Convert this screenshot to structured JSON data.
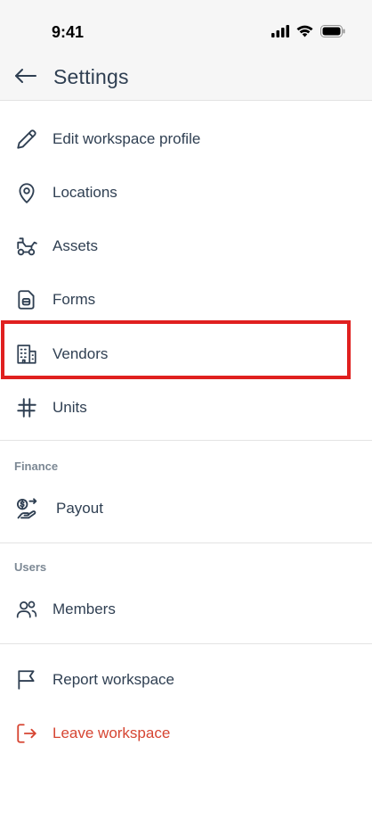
{
  "status_bar": {
    "time": "9:41"
  },
  "header": {
    "title": "Settings"
  },
  "general_items": [
    {
      "label": "Edit workspace profile",
      "icon": "pencil-icon"
    },
    {
      "label": "Locations",
      "icon": "map-pin-icon"
    },
    {
      "label": "Assets",
      "icon": "truck-icon"
    },
    {
      "label": "Forms",
      "icon": "form-icon"
    },
    {
      "label": "Vendors",
      "icon": "building-icon"
    },
    {
      "label": "Units",
      "icon": "hash-icon"
    }
  ],
  "finance": {
    "title": "Finance",
    "items": [
      {
        "label": "Payout",
        "icon": "payout-icon"
      }
    ]
  },
  "users": {
    "title": "Users",
    "items": [
      {
        "label": "Members",
        "icon": "users-icon"
      }
    ]
  },
  "workspace_items": [
    {
      "label": "Report workspace",
      "icon": "flag-icon"
    },
    {
      "label": "Leave workspace",
      "icon": "logout-icon"
    }
  ],
  "colors": {
    "text": "#2f3f52",
    "danger": "#d64532",
    "highlight": "#e0201f",
    "section": "#7c8894"
  }
}
